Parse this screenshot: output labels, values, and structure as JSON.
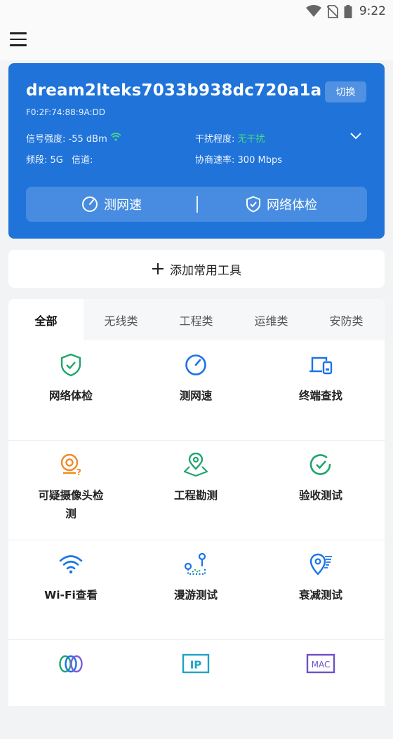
{
  "status_bar": {
    "time": "9:22"
  },
  "wifi": {
    "ssid": "dream2lteks7033b938dc720a1a",
    "switch_label": "切换",
    "mac": "F0:2F:74:88:9A:DD",
    "signal_label": "信号强度:",
    "signal_value": "-55 dBm",
    "interference_label": "干扰程度:",
    "interference_value": "无干扰",
    "band_label": "频段:",
    "band_value": "5G",
    "channel_label": "信道:",
    "channel_value": "",
    "rate_label": "协商速率:",
    "rate_value": "300 Mbps",
    "speedtest_label": "测网速",
    "checkup_label": "网络体检"
  },
  "add_tools_label": "添加常用工具",
  "tabs": [
    "全部",
    "无线类",
    "工程类",
    "运维类",
    "安防类"
  ],
  "tools": [
    {
      "label": "网络体检",
      "icon": "shield-check-icon"
    },
    {
      "label": "测网速",
      "icon": "speedometer-icon"
    },
    {
      "label": "终端查找",
      "icon": "devices-icon"
    },
    {
      "label": "可疑摄像头检测",
      "label_line1": "可疑摄像头检",
      "label_line2": "测",
      "icon": "camera-question-icon"
    },
    {
      "label": "工程勘测",
      "icon": "location-survey-icon"
    },
    {
      "label": "验收测试",
      "icon": "check-circle-icon"
    },
    {
      "label": "Wi-Fi查看",
      "icon": "wifi-icon"
    },
    {
      "label": "漫游测试",
      "icon": "roaming-path-icon"
    },
    {
      "label": "衰减测试",
      "icon": "signal-attenuation-icon"
    },
    {
      "label": "",
      "icon": "interference-rings-icon"
    },
    {
      "label": "",
      "icon": "ip-lookup-icon"
    },
    {
      "label": "",
      "icon": "mac-lookup-icon"
    }
  ],
  "colors": {
    "card_blue": "#1f73d9",
    "green": "#1fa56c",
    "blue": "#1a73e8",
    "orange": "#f08a24",
    "purple": "#7b5cd6"
  }
}
